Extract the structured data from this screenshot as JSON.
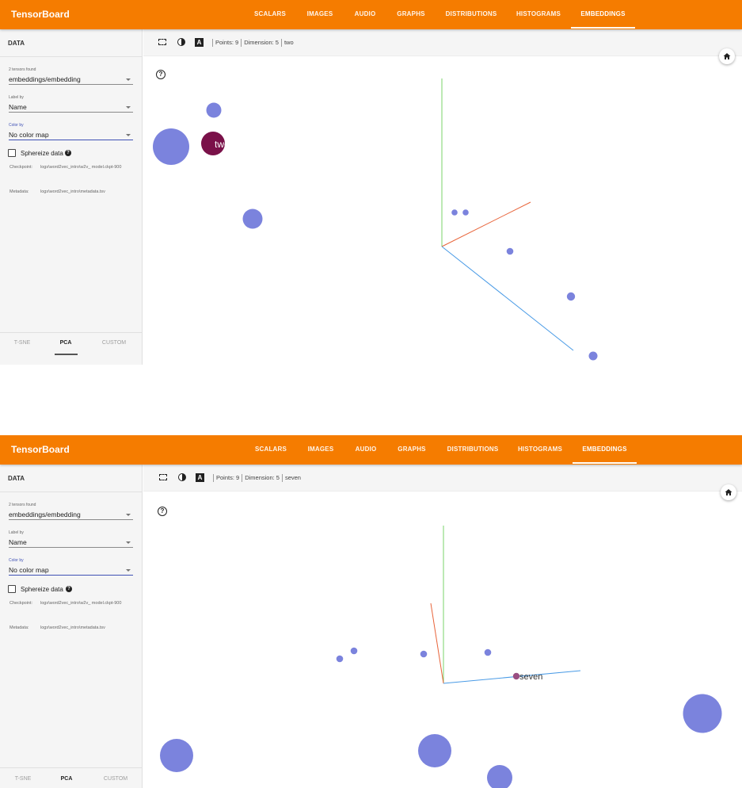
{
  "app": {
    "brand": "TensorBoard",
    "nav_tabs": [
      "SCALARS",
      "IMAGES",
      "AUDIO",
      "GRAPHS",
      "DISTRIBUTIONS",
      "HISTOGRAMS",
      "EMBEDDINGS"
    ],
    "active_tab": "EMBEDDINGS"
  },
  "sidebar": {
    "title": "DATA",
    "tensors_found": "2 tensors found",
    "tensor_value": "embeddings/embedding",
    "label_by_label": "Label by",
    "label_by_value": "Name",
    "color_by_label": "Color by",
    "color_by_value": "No color map",
    "sphereize_label": "Sphereize data",
    "checkpoint_key": "Checkpoint:",
    "checkpoint_val": "logs\\word2vec_intro\\w2v_ model.ckpt-900",
    "metadata_key": "Metadata:",
    "metadata_val": "logs\\word2vec_intro\\metadata.tsv",
    "projection_tabs": [
      "T-SNE",
      "PCA",
      "CUSTOM"
    ],
    "active_projection": "PCA"
  },
  "panels": [
    {
      "toolbar": {
        "points": "Points: 9",
        "dimension": "Dimension: 5",
        "selected": "two"
      },
      "hover_label": "two",
      "colors": {
        "point": "#7b83dd",
        "selected": "#7a1149",
        "axis_x": "#e8643a",
        "axis_y": "#7ad36a",
        "axis_z": "#4a9be6"
      }
    },
    {
      "toolbar": {
        "points": "Points: 9",
        "dimension": "Dimension: 5",
        "selected": "seven"
      },
      "hover_label": "seven",
      "colors": {
        "point": "#7b83dd",
        "selected": "#9a4f82",
        "axis_x": "#e8643a",
        "axis_y": "#7ad36a",
        "axis_z": "#4a9be6"
      }
    }
  ],
  "icons": {
    "selection": "selection-rect-icon",
    "night_mode": "night-mode-icon",
    "labels": "label-toggle-icon",
    "home": "home-icon",
    "help": "help-icon"
  }
}
